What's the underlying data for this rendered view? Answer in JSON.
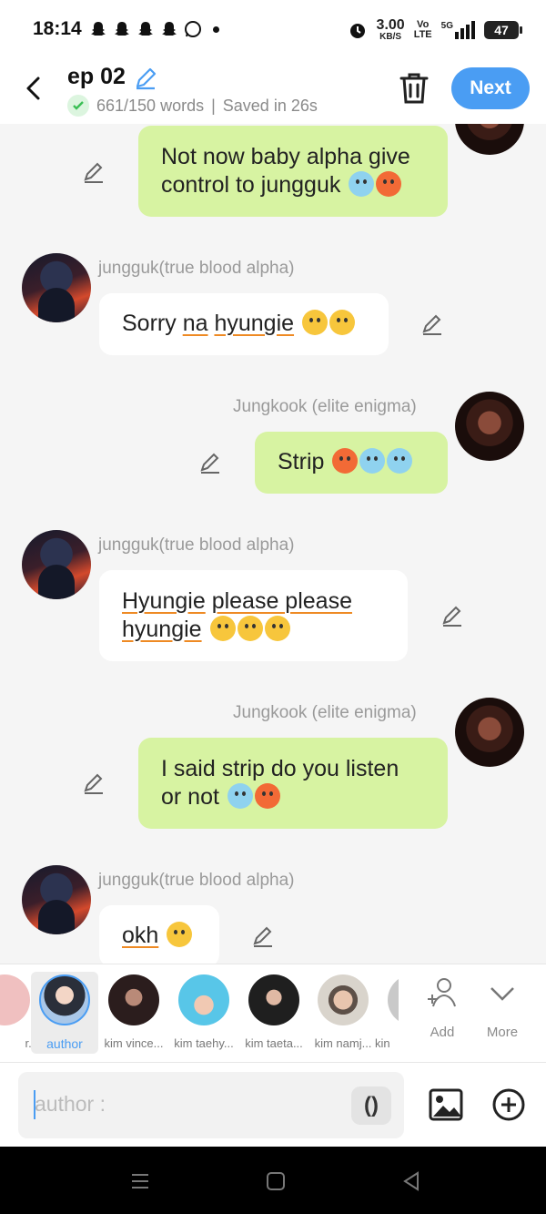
{
  "status": {
    "time": "18:14",
    "net_speed_value": "3.00",
    "net_speed_unit": "KB/S",
    "volte_top": "Vo",
    "volte_bottom": "LTE",
    "network": "5G",
    "battery": "47"
  },
  "header": {
    "title": "ep 02",
    "word_count": "661/150 words",
    "separator": "|",
    "saved": "Saved in 26s",
    "next_label": "Next"
  },
  "messages": [
    {
      "side": "right",
      "name": "",
      "text": "Not now baby alpha give control to jungguk",
      "emojis": [
        "cold",
        "angry"
      ]
    },
    {
      "side": "left",
      "name": "jungguk(true blood alpha)",
      "text_parts": [
        "Sorry ",
        "na",
        " ",
        "hyungie"
      ],
      "emojis": [
        "cry",
        "cry"
      ]
    },
    {
      "side": "right",
      "name": "Jungkook (elite enigma)",
      "text": "Strip",
      "emojis": [
        "angry",
        "cold",
        "cold"
      ]
    },
    {
      "side": "left",
      "name": "jungguk(true blood alpha)",
      "text_line1_parts": [
        "Hyungie",
        " ",
        "please please"
      ],
      "text_line2": "hyungie",
      "emojis": [
        "blank",
        "cry",
        "cry"
      ]
    },
    {
      "side": "right",
      "name": "Jungkook (elite enigma)",
      "text": "I said strip do you listen or not",
      "emojis": [
        "cold",
        "angry"
      ]
    },
    {
      "side": "left",
      "name": "jungguk(true blood alpha)",
      "text": "okh",
      "emojis": [
        "plead"
      ]
    }
  ],
  "characters": [
    {
      "label": "r...",
      "color": "#f0c0c0"
    },
    {
      "label": "author",
      "color": "#6a8fb5",
      "selected": true
    },
    {
      "label": "kim vince...",
      "color": "#3a2a2a"
    },
    {
      "label": "kim taehy...",
      "color": "#58c6e8"
    },
    {
      "label": "kim taeta...",
      "color": "#1f1f1f"
    },
    {
      "label": "kim namj...",
      "color": "#d9c8b8"
    },
    {
      "label": "kin",
      "color": "#c9c9c9"
    }
  ],
  "char_actions": {
    "add_label": "Add",
    "more_label": "More"
  },
  "composer": {
    "placeholder": "author :",
    "paren_label": "()"
  },
  "colors": {
    "accent": "#4a9df3",
    "my_bubble": "#d7f3a2",
    "their_bubble": "#ffffff",
    "underline": "#ee8a24"
  }
}
